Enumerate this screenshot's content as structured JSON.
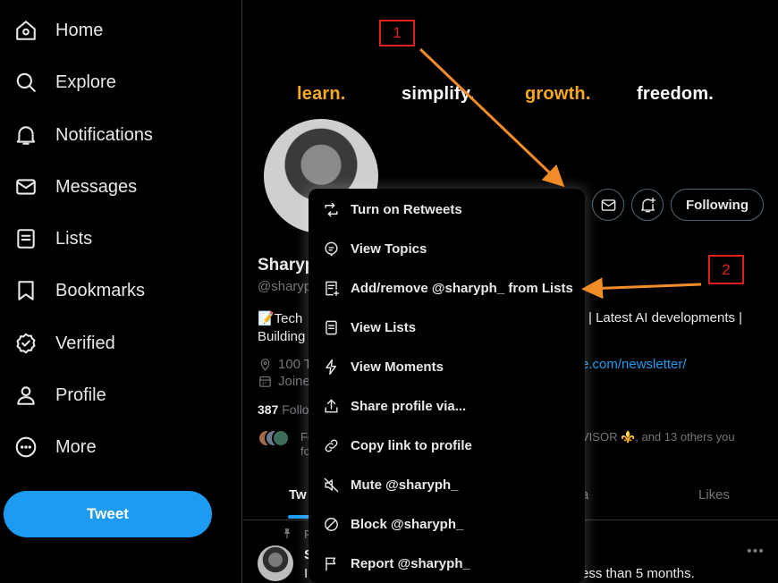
{
  "sidebar": {
    "items": [
      {
        "label": "Home",
        "icon": "home-icon"
      },
      {
        "label": "Explore",
        "icon": "search-icon"
      },
      {
        "label": "Notifications",
        "icon": "bell-icon"
      },
      {
        "label": "Messages",
        "icon": "envelope-icon"
      },
      {
        "label": "Lists",
        "icon": "list-icon"
      },
      {
        "label": "Bookmarks",
        "icon": "bookmark-icon"
      },
      {
        "label": "Verified",
        "icon": "verified-badge-icon"
      },
      {
        "label": "Profile",
        "icon": "person-icon"
      },
      {
        "label": "More",
        "icon": "more-circle-icon"
      }
    ],
    "tweet_button": "Tweet"
  },
  "banner": {
    "words": [
      {
        "text": "learn.",
        "color": "#f7a81b"
      },
      {
        "text": "simplify.",
        "color": "#ffffff"
      },
      {
        "text": "growth.",
        "color": "#f7a81b"
      },
      {
        "text": "freedom.",
        "color": "#ffffff"
      }
    ]
  },
  "profile": {
    "name": "Sharyp",
    "handle": "@sharyp",
    "bio_line1": "📝Tech",
    "bio_line2": "Building",
    "bio_right": "| Latest AI developments |",
    "location": "100 T",
    "joined": "Joine",
    "link": "e.com/newsletter/",
    "follow_count": "387",
    "follow_label": "Follo",
    "followed_by_1": "Fo",
    "followed_by_2": "fo",
    "followed_by_right": "VISOR ⚜️, and 13 others you",
    "following_button": "Following"
  },
  "tabs": {
    "tweets": "Tw",
    "media": "edia",
    "likes": "Likes"
  },
  "pinned": {
    "label": "P",
    "name": "S",
    "text_left": "I",
    "text_right": "ess than 5 months."
  },
  "menu": {
    "items": [
      {
        "label": "Turn on Retweets",
        "icon": "retweet-icon"
      },
      {
        "label": "View Topics",
        "icon": "topics-icon"
      },
      {
        "label": "Add/remove @sharyph_ from Lists",
        "icon": "list-add-icon"
      },
      {
        "label": "View Lists",
        "icon": "list-icon"
      },
      {
        "label": "View Moments",
        "icon": "lightning-icon"
      },
      {
        "label": "Share profile via...",
        "icon": "share-icon"
      },
      {
        "label": "Copy link to profile",
        "icon": "link-icon"
      },
      {
        "label": "Mute @sharyph_",
        "icon": "mute-icon"
      },
      {
        "label": "Block @sharyph_",
        "icon": "block-icon"
      },
      {
        "label": "Report @sharyph_",
        "icon": "flag-icon"
      }
    ]
  },
  "annotations": {
    "step1": "1",
    "step2": "2",
    "arrow_color": "#f28c28",
    "box_color": "#e0201c"
  }
}
